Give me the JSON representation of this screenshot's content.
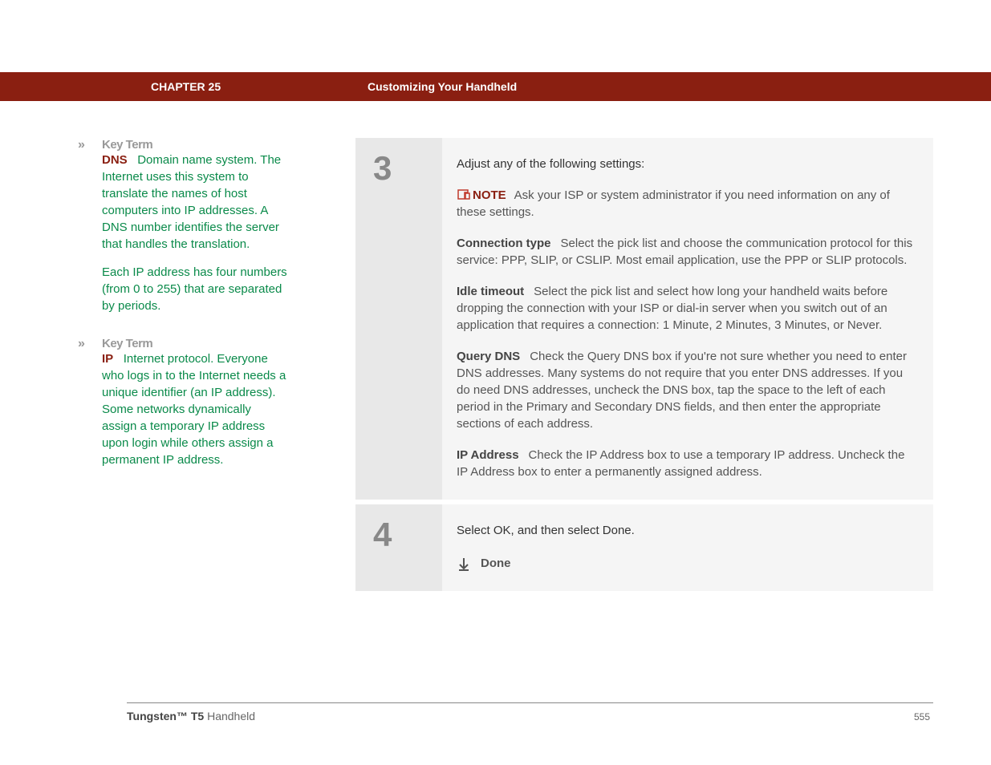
{
  "header": {
    "chapter": "CHAPTER 25",
    "section": "Customizing Your Handheld"
  },
  "sidebar": {
    "key_terms": [
      {
        "label": "Key Term",
        "term": "DNS",
        "definition": "Domain name system. The Internet uses this system to translate the names of host computers into IP addresses. A DNS number identifies the server that handles the translation.",
        "extra": "Each IP address has four numbers (from 0 to 255) that are separated by periods."
      },
      {
        "label": "Key Term",
        "term": "IP",
        "definition": "Internet protocol. Everyone who logs in to the Internet needs a unique identifier (an IP address). Some networks dynamically assign a temporary IP address upon login while others assign a permanent IP address."
      }
    ]
  },
  "steps": {
    "step3": {
      "number": "3",
      "intro": "Adjust any of the following settings:",
      "note_label": "NOTE",
      "note_text": "Ask your ISP or system administrator if you need information on any of these settings.",
      "settings": [
        {
          "name": "Connection type",
          "text": "Select the pick list and choose the communication protocol for this service: PPP, SLIP, or CSLIP. Most email application, use the PPP or SLIP protocols."
        },
        {
          "name": "Idle timeout",
          "text": "Select the pick list and select how long your handheld waits before dropping the connection with your ISP or dial-in server when you switch out of an application that requires a connection: 1 Minute, 2 Minutes, 3 Minutes, or Never."
        },
        {
          "name": "Query DNS",
          "text": "Check the Query DNS box if you're not sure whether you need to enter DNS addresses. Many systems do not require that you enter DNS addresses. If you do need DNS addresses, uncheck the DNS box, tap the space to the left of each period in the Primary and Secondary DNS fields, and then enter the appropriate sections of each address."
        },
        {
          "name": "IP Address",
          "text": "Check the IP Address box to use a temporary IP address. Uncheck the IP Address box to enter a permanently assigned address."
        }
      ]
    },
    "step4": {
      "number": "4",
      "text": "Select OK, and then select Done.",
      "done": "Done"
    }
  },
  "footer": {
    "product_bold": "Tungsten™ T5",
    "product_rest": " Handheld",
    "page": "555"
  }
}
